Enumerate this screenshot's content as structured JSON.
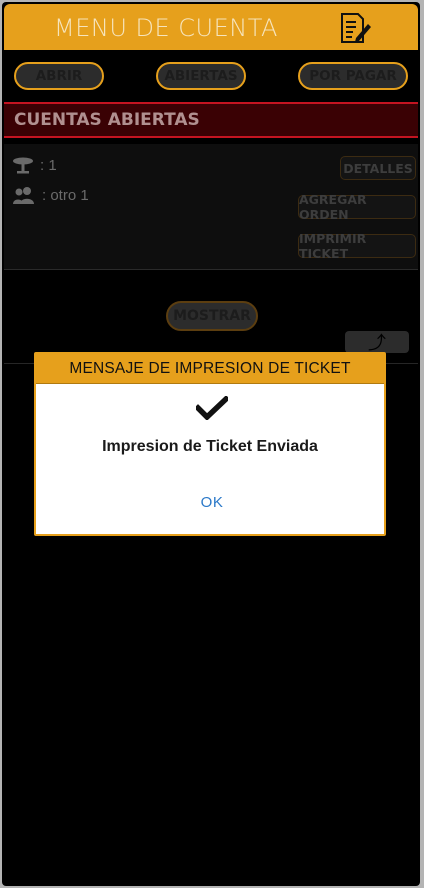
{
  "header": {
    "title": "MENU DE CUENTA",
    "icon": "edit-document-icon"
  },
  "toolbar": {
    "abrir": "ABRIR",
    "abiertas": "ABIERTAS",
    "por_pagar": "POR PAGAR"
  },
  "section": {
    "title": "CUENTAS ABIERTAS"
  },
  "account": {
    "table_icon": "table-icon",
    "table_value": ": 1",
    "people_icon": "users-icon",
    "people_value": ": otro 1",
    "detalles": "DETALLES",
    "agregar_orden": "AGREGAR ORDEN",
    "imprimir_ticket": "IMPRIMIR TICKET"
  },
  "list": {
    "mostrar": "MOSTRAR",
    "up_icon": "arrow-up-icon",
    "up_glyph": "⤴"
  },
  "dialog": {
    "title": "MENSAJE DE IMPRESION DE TICKET",
    "icon": "checkmark-icon",
    "message": "Impresion de Ticket Enviada",
    "ok": "OK"
  },
  "colors": {
    "accent": "#e6a01c",
    "section_bg": "#3a0104",
    "link": "#2a78c8"
  }
}
